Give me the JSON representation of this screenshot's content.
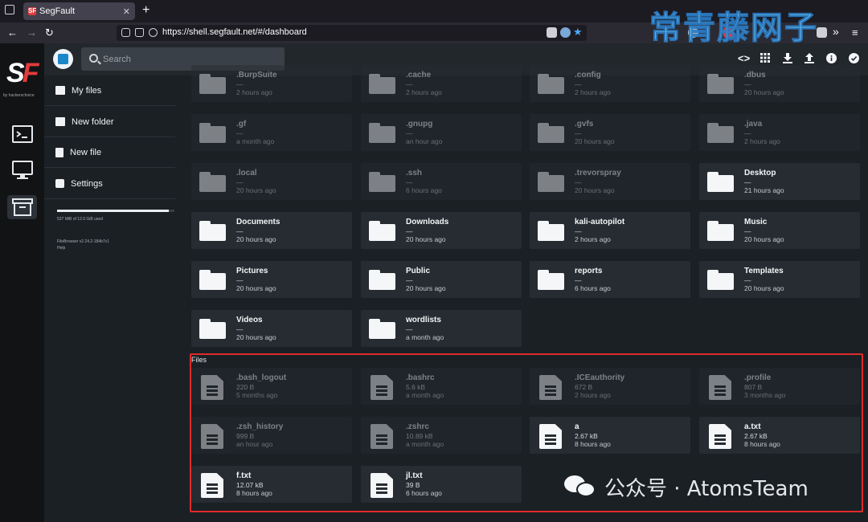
{
  "browser": {
    "tab_title": "SegFault",
    "tab_favicon": "SF",
    "url_prefix": "https://shell.",
    "url_domain": "segfault.net",
    "url_suffix": "/#/dashboard"
  },
  "watermark_top": "常青藤网子",
  "watermark_bottom": "公众号 · AtomsTeam",
  "brand": {
    "logo_s": "S",
    "logo_f": "F",
    "logo_sub": "by hackerschoice"
  },
  "header": {
    "search_placeholder": "Search"
  },
  "sidebar": {
    "items": [
      {
        "label": "My files",
        "icon": "folder-icon"
      },
      {
        "label": "New folder",
        "icon": "folder-plus-icon"
      },
      {
        "label": "New file",
        "icon": "file-icon"
      },
      {
        "label": "Settings",
        "icon": "gear-icon"
      }
    ],
    "usage_text": "537 MiB of 12.0 GiB used",
    "usage_fraction": 0.95,
    "version_line1": "FileBrowser v2.24.2-184b7c1",
    "version_line2": "Help"
  },
  "folders": [
    {
      "name": ".BurpSuite",
      "size": "—",
      "time": "2 hours ago",
      "hidden": true
    },
    {
      "name": ".cache",
      "size": "—",
      "time": "2 hours ago",
      "hidden": true
    },
    {
      "name": ".config",
      "size": "—",
      "time": "2 hours ago",
      "hidden": true
    },
    {
      "name": ".dbus",
      "size": "—",
      "time": "20 hours ago",
      "hidden": true
    },
    {
      "name": ".gf",
      "size": "—",
      "time": "a month ago",
      "hidden": true
    },
    {
      "name": ".gnupg",
      "size": "—",
      "time": "an hour ago",
      "hidden": true
    },
    {
      "name": ".gvfs",
      "size": "—",
      "time": "20 hours ago",
      "hidden": true
    },
    {
      "name": ".java",
      "size": "—",
      "time": "2 hours ago",
      "hidden": true
    },
    {
      "name": ".local",
      "size": "—",
      "time": "20 hours ago",
      "hidden": true
    },
    {
      "name": ".ssh",
      "size": "—",
      "time": "6 hours ago",
      "hidden": true
    },
    {
      "name": ".trevorspray",
      "size": "—",
      "time": "20 hours ago",
      "hidden": true
    },
    {
      "name": "Desktop",
      "size": "—",
      "time": "21 hours ago",
      "hidden": false
    },
    {
      "name": "Documents",
      "size": "—",
      "time": "20 hours ago",
      "hidden": false
    },
    {
      "name": "Downloads",
      "size": "—",
      "time": "20 hours ago",
      "hidden": false
    },
    {
      "name": "kali-autopilot",
      "size": "—",
      "time": "2 hours ago",
      "hidden": false
    },
    {
      "name": "Music",
      "size": "—",
      "time": "20 hours ago",
      "hidden": false
    },
    {
      "name": "Pictures",
      "size": "—",
      "time": "20 hours ago",
      "hidden": false
    },
    {
      "name": "Public",
      "size": "—",
      "time": "20 hours ago",
      "hidden": false
    },
    {
      "name": "reports",
      "size": "—",
      "time": "6 hours ago",
      "hidden": false
    },
    {
      "name": "Templates",
      "size": "—",
      "time": "20 hours ago",
      "hidden": false
    },
    {
      "name": "Videos",
      "size": "—",
      "time": "20 hours ago",
      "hidden": false
    },
    {
      "name": "wordlists",
      "size": "—",
      "time": "a month ago",
      "hidden": false
    }
  ],
  "files_label": "Files",
  "files": [
    {
      "name": ".bash_logout",
      "size": "220 B",
      "time": "5 months ago",
      "hidden": true
    },
    {
      "name": ".bashrc",
      "size": "5.6 kB",
      "time": "a month ago",
      "hidden": true
    },
    {
      "name": ".ICEauthority",
      "size": "672 B",
      "time": "2 hours ago",
      "hidden": true
    },
    {
      "name": ".profile",
      "size": "807 B",
      "time": "3 months ago",
      "hidden": true
    },
    {
      "name": ".zsh_history",
      "size": "999 B",
      "time": "an hour ago",
      "hidden": true
    },
    {
      "name": ".zshrc",
      "size": "10.89 kB",
      "time": "a month ago",
      "hidden": true
    },
    {
      "name": "a",
      "size": "2.67 kB",
      "time": "8 hours ago",
      "hidden": false
    },
    {
      "name": "a.txt",
      "size": "2.67 kB",
      "time": "8 hours ago",
      "hidden": false
    },
    {
      "name": "f.txt",
      "size": "12.07 kB",
      "time": "8 hours ago",
      "hidden": false
    },
    {
      "name": "jl.txt",
      "size": "39 B",
      "time": "6 hours ago",
      "hidden": false
    }
  ]
}
